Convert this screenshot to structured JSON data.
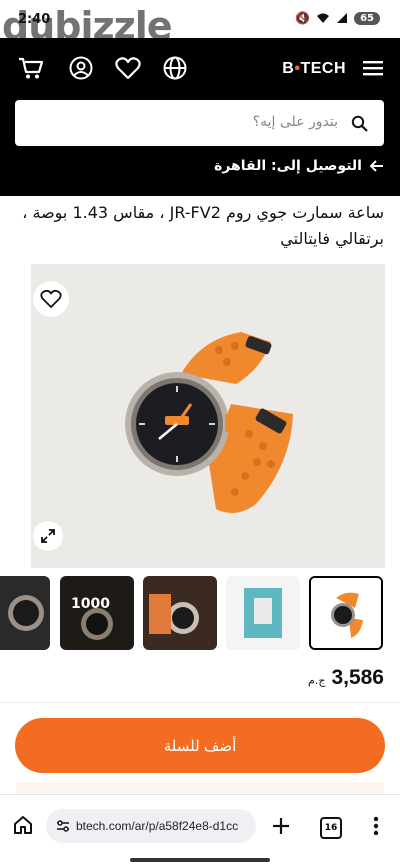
{
  "status": {
    "time": "2:40",
    "battery": "65",
    "watermark": "dubizzle"
  },
  "header": {
    "logo_left": "B",
    "logo_right": "TECH"
  },
  "search": {
    "placeholder": "بتدور على إيه؟"
  },
  "delivery": {
    "label": "التوصيل إلى: القاهرة"
  },
  "product": {
    "title": "ساعة سمارت جوي روم JR-FV2 ، مقاس 1.43 بوصة ، برتقالي فايتالتي",
    "price": "3,586",
    "currency": "ج.م",
    "thumb_text": "1000"
  },
  "cart": {
    "label": "أضف للسلة"
  },
  "browser": {
    "url": "btech.com/ar/p/a58f24e8-d1cc",
    "tabs": "16"
  },
  "colors": {
    "accent": "#f36c21",
    "header": "#000000",
    "watch_band": "#f0892e"
  },
  "icons": [
    "cart-icon",
    "account-icon",
    "heart-icon",
    "globe-icon",
    "menu-icon",
    "search-icon",
    "arrow-left-icon",
    "favorite-icon",
    "expand-icon",
    "home-icon",
    "tune-icon",
    "plus-icon",
    "more-icon"
  ]
}
